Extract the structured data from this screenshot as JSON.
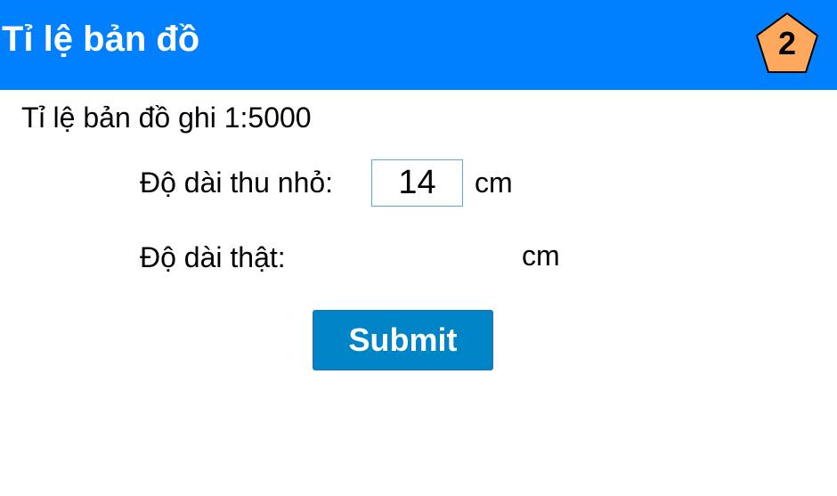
{
  "header": {
    "title": "Tỉ lệ bản đồ",
    "badge_number": "2",
    "badge_color": "#ffa95e",
    "background_color": "#0080ff"
  },
  "problem": {
    "scale_text": "Tỉ lệ bản đồ ghi 1:5000",
    "reduced_length_label": "Độ dài thu nhỏ:",
    "reduced_length_value": "14",
    "reduced_length_unit": "cm",
    "real_length_label": "Độ dài thật:",
    "real_length_value": "",
    "real_length_unit": "cm"
  },
  "actions": {
    "submit_label": "Submit",
    "submit_color": "#0084c8"
  }
}
